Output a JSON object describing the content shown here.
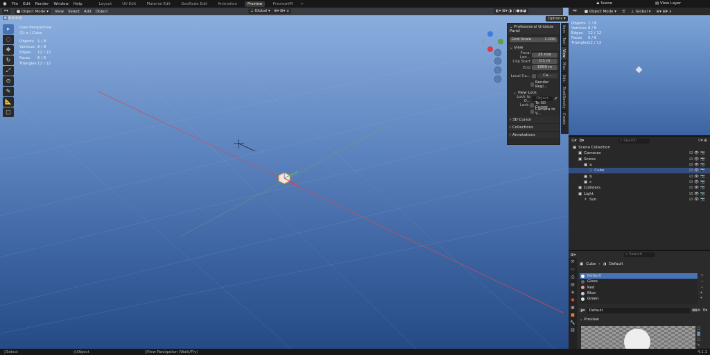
{
  "topbar": {
    "menus": [
      "File",
      "Edit",
      "Render",
      "Window",
      "Help"
    ],
    "tabs": [
      "Layout",
      "UV Edit",
      "Material Edit",
      "GeoNode Edit",
      "Animation",
      "Preview",
      "PreviewVR"
    ],
    "active_tab": "Preview",
    "scene": "Scene",
    "view_layer": "View Layer"
  },
  "viewport": {
    "mode": "Object Mode",
    "menus": [
      "View",
      "Select",
      "Add",
      "Object"
    ],
    "orientation": "Global",
    "options": "Options",
    "overlay_title": "User Perspective",
    "overlay_sub": "(1) a | Cube",
    "stats": [
      [
        "Objects",
        "1 / 8"
      ],
      [
        "Vertices",
        "8 / 8"
      ],
      [
        "Edges",
        "12 / 12"
      ],
      [
        "Faces",
        "6 / 6"
      ],
      [
        "Triangles",
        "12 / 12"
      ]
    ]
  },
  "npanel": {
    "gridsize_title": "Professional Gridsize Panel",
    "grid_scale_label": "Grid Scale",
    "grid_scale": "1.000",
    "view_title": "View",
    "focal_label": "Focal Len...",
    "focal": "25 mm",
    "clip_start_label": "Clip Start",
    "clip_start": "0.1 m",
    "end_label": "End",
    "end": "1000 m",
    "local_label": "Local Ca...",
    "local_val": "Ca...",
    "render_region": "Render Regi...",
    "view_lock": "View Lock",
    "lock_to_label": "Lock to O...",
    "lock_obj": "Object",
    "lock_label": "Lock",
    "to_cursor": "To 3D Cursor",
    "camera_to_view": "Camera to V...",
    "cursor": "3D Cursor",
    "collections": "Collections",
    "annotations": "Annotations",
    "tabs": [
      "Item",
      "Tool",
      "View",
      "Misc",
      "Edit",
      "TexelDensity",
      "Create"
    ]
  },
  "right_viewport": {
    "mode": "Object Mode",
    "orientation": "Global",
    "stats": [
      [
        "Objects",
        "1 / 8"
      ],
      [
        "Vertices",
        "8 / 8"
      ],
      [
        "Edges",
        "12 / 12"
      ],
      [
        "Faces",
        "6 / 6"
      ],
      [
        "Triangles",
        "12 / 12"
      ]
    ]
  },
  "outliner": {
    "search": "Search",
    "items": [
      {
        "label": "Scene Collection",
        "depth": 0
      },
      {
        "label": "Cameras",
        "depth": 1
      },
      {
        "label": "Scene",
        "depth": 1
      },
      {
        "label": "a",
        "depth": 2
      },
      {
        "label": "Cube",
        "depth": 3,
        "selected": true
      },
      {
        "label": "b",
        "depth": 2
      },
      {
        "label": "c",
        "depth": 2
      },
      {
        "label": "Colliders",
        "depth": 1
      },
      {
        "label": "Light",
        "depth": 1
      },
      {
        "label": "Sun",
        "depth": 2
      }
    ]
  },
  "properties": {
    "search": "Search",
    "object": "Cube",
    "material": "Default",
    "slots": [
      "Default",
      "Glass",
      "Red",
      "Blue",
      "Green"
    ],
    "slot_colors": [
      "#ffffff",
      "#666666",
      "#e8a0a0",
      "#c8c8f0",
      "#d0f0d0"
    ],
    "material_field": "Default",
    "preview": "Preview",
    "version": "4.1.1"
  },
  "status": {
    "select": "Select",
    "object": "Object",
    "nav": "View Navigation (Walk/Fly)"
  }
}
